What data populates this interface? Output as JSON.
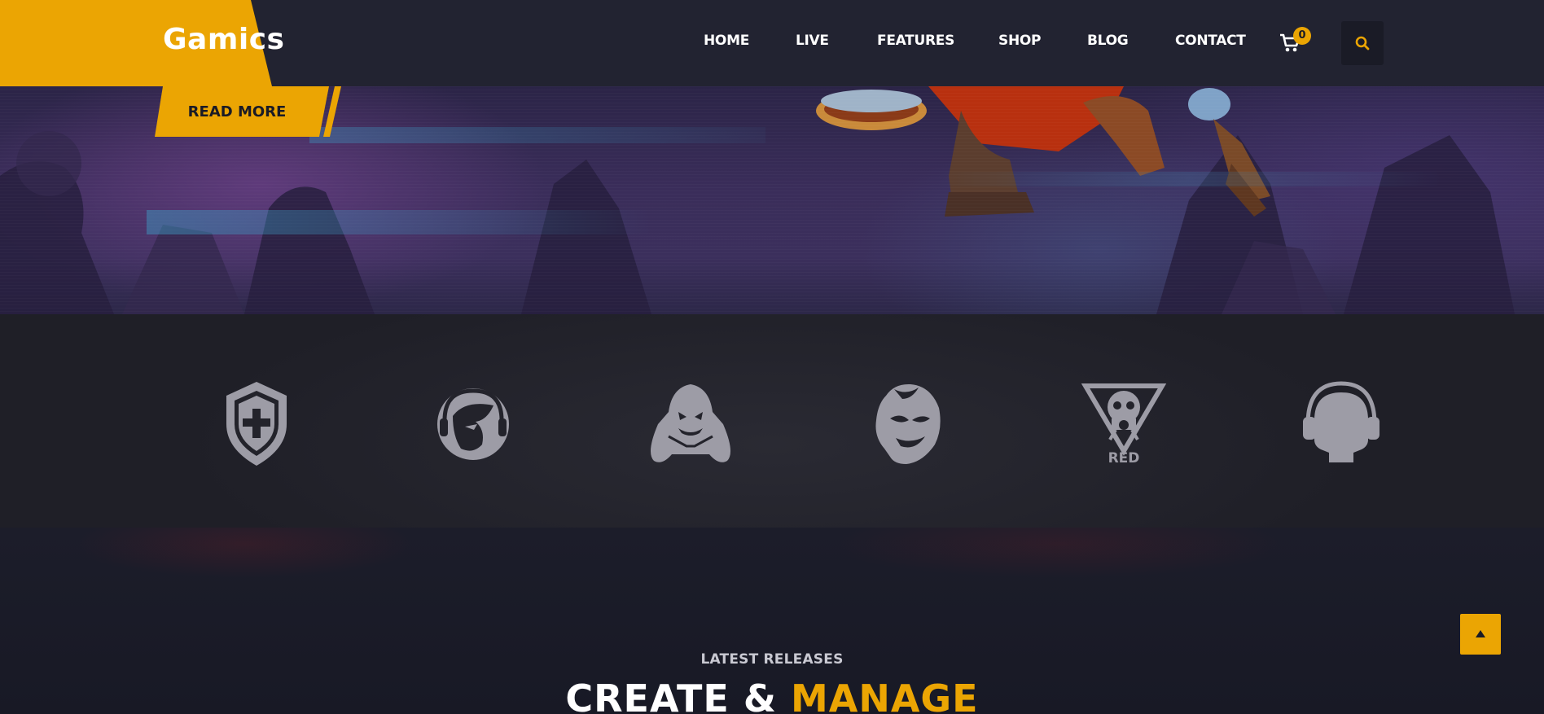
{
  "header": {
    "logo": "Gamics",
    "nav": [
      {
        "label": "HOME"
      },
      {
        "label": "LIVE"
      },
      {
        "label": "FEATURES"
      },
      {
        "label": "SHOP"
      },
      {
        "label": "BLOG"
      },
      {
        "label": "CONTACT"
      }
    ],
    "cart_count": "0",
    "cart_icon": "cart-icon",
    "search_icon": "search-icon"
  },
  "hero": {
    "read_more_label": "READ MORE"
  },
  "brands": {
    "logos": [
      {
        "icon": "shield-cross-icon"
      },
      {
        "icon": "headset-gamer-icon"
      },
      {
        "icon": "gamepad-ghost-icon"
      },
      {
        "icon": "devil-mascot-icon"
      },
      {
        "icon": "red-skull-gasmask-icon",
        "text": "RED"
      },
      {
        "icon": "headset-head-icon"
      }
    ]
  },
  "section": {
    "subtitle": "LATEST RELEASES",
    "title_part1": "CREATE & ",
    "title_part2": "MANAGE"
  },
  "colors": {
    "accent": "#eba503",
    "header_bg": "#222331",
    "brands_bg": "#23232b",
    "icon_gray": "#9d9ca6"
  }
}
